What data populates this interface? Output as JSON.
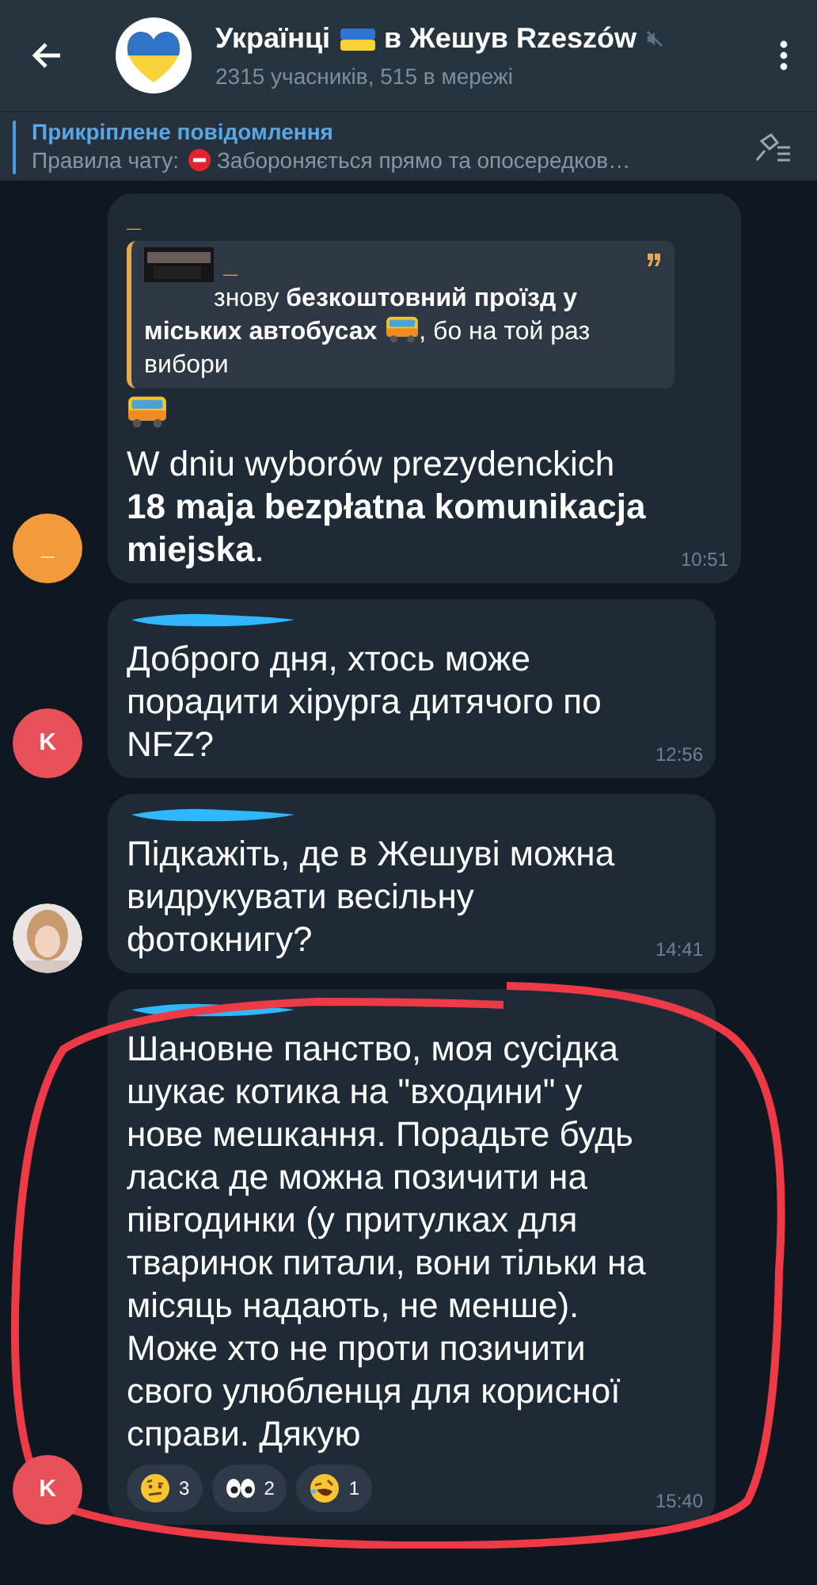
{
  "header": {
    "title_start": "Українці",
    "title_end": "в Жешув Rzeszów",
    "muted": true,
    "subtitle": "2315 учасників, 515 в мережі"
  },
  "pinned": {
    "title": "Прикріплене повідомлення",
    "label": "Правила чату:",
    "text": "Забороняється прямо та опосередков…"
  },
  "messages": [
    {
      "sender": "_",
      "redacted": false,
      "avatar": {
        "kind": "letter",
        "initial": "_",
        "color": "#f39a3d"
      },
      "quote": {
        "author": "_",
        "text_start": "знову **безкоштовний проїзд у міських автобусах**",
        "text_end": ", бо на той раз вибори"
      },
      "icon_line": true,
      "text": "W dniu wyborów prezydenckich **18 maja bezpłatna komunikacja miejska**.",
      "time": "10:51"
    },
    {
      "redacted": true,
      "avatar": {
        "kind": "letter",
        "initial": "K",
        "color": "#e8505a"
      },
      "text": "Доброго дня, хтось може порадити хірурга дитячого по NFZ?",
      "time": "12:56"
    },
    {
      "redacted": true,
      "text": "Підкажіть, де в Жешуві можна видрукувати весільну фотокнигу?",
      "time": "14:41"
    },
    {
      "redacted": true,
      "avatar": {
        "kind": "letter",
        "initial": "K",
        "color": "#e8505a"
      },
      "text": "Шановне панство, моя сусідка шукає котика на \"входини\" у нове мешкання. Порадьте будь ласка де можна позичити на півгодинки (у притулках для тваринок питали, вони тільки на місяць надають, не менше). Може хто не проти позичити свого улюбленця для корисної справи. Дякую",
      "highlighted": true,
      "reactions": [
        {
          "kind": "raised-eyebrow",
          "count": "3"
        },
        {
          "kind": "eyes",
          "count": "2"
        },
        {
          "kind": "laughing",
          "count": "1"
        }
      ],
      "time": "15:40"
    }
  ]
}
